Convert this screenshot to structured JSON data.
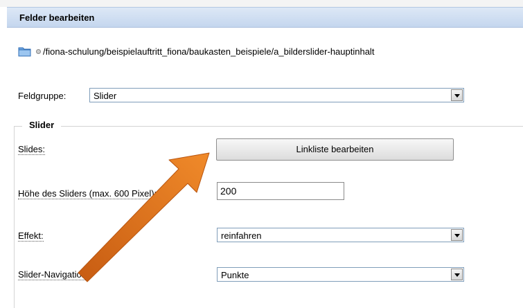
{
  "header": {
    "title": "Felder bearbeiten"
  },
  "path": {
    "text": "/fiona-schulung/beispielauftritt_fiona/baukasten_beispiele/a_bilderslider-hauptinhalt"
  },
  "fieldgroup": {
    "label": "Feldgruppe:",
    "value": "Slider"
  },
  "section": {
    "legend": "Slider"
  },
  "fields": {
    "slides_label": "Slides:",
    "slides_button": "Linkliste bearbeiten",
    "height_label": "Höhe des Sliders (max. 600 Pixel):",
    "height_value": "200",
    "effect_label": "Effekt:",
    "effect_value": "reinfahren",
    "nav_label": "Slider-Navigation:",
    "nav_value": "Punkte"
  },
  "colors": {
    "header_bg": "#c4d6ee",
    "arrow": "#e8761e",
    "border": "#7f9db9"
  },
  "icons": {
    "folder": "folder-icon",
    "bullet": "bullet-icon",
    "dropdown": "chevron-down-icon",
    "annotation": "arrow-icon"
  }
}
